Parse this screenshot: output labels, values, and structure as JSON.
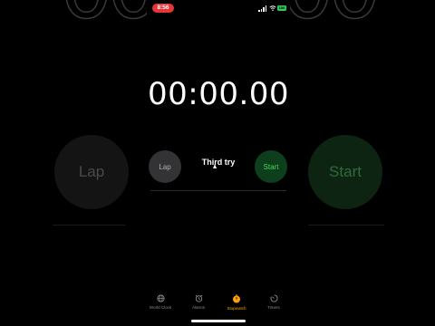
{
  "status_bar": {
    "time": "8:56",
    "battery": "100"
  },
  "stopwatch": {
    "time": "00:00.00",
    "lap_label": "Lap",
    "start_label": "Start"
  },
  "caption": "Third try",
  "tabs": [
    {
      "label": "World Clock",
      "icon": "globe-icon",
      "active": false
    },
    {
      "label": "Alarms",
      "icon": "alarm-icon",
      "active": false
    },
    {
      "label": "Stopwatch",
      "icon": "stopwatch-icon",
      "active": true
    },
    {
      "label": "Timers",
      "icon": "timer-icon",
      "active": false
    }
  ],
  "colors": {
    "accent": "#ff9f0a",
    "start_green": "#3ddc58",
    "status_pill": "#e5363a"
  }
}
